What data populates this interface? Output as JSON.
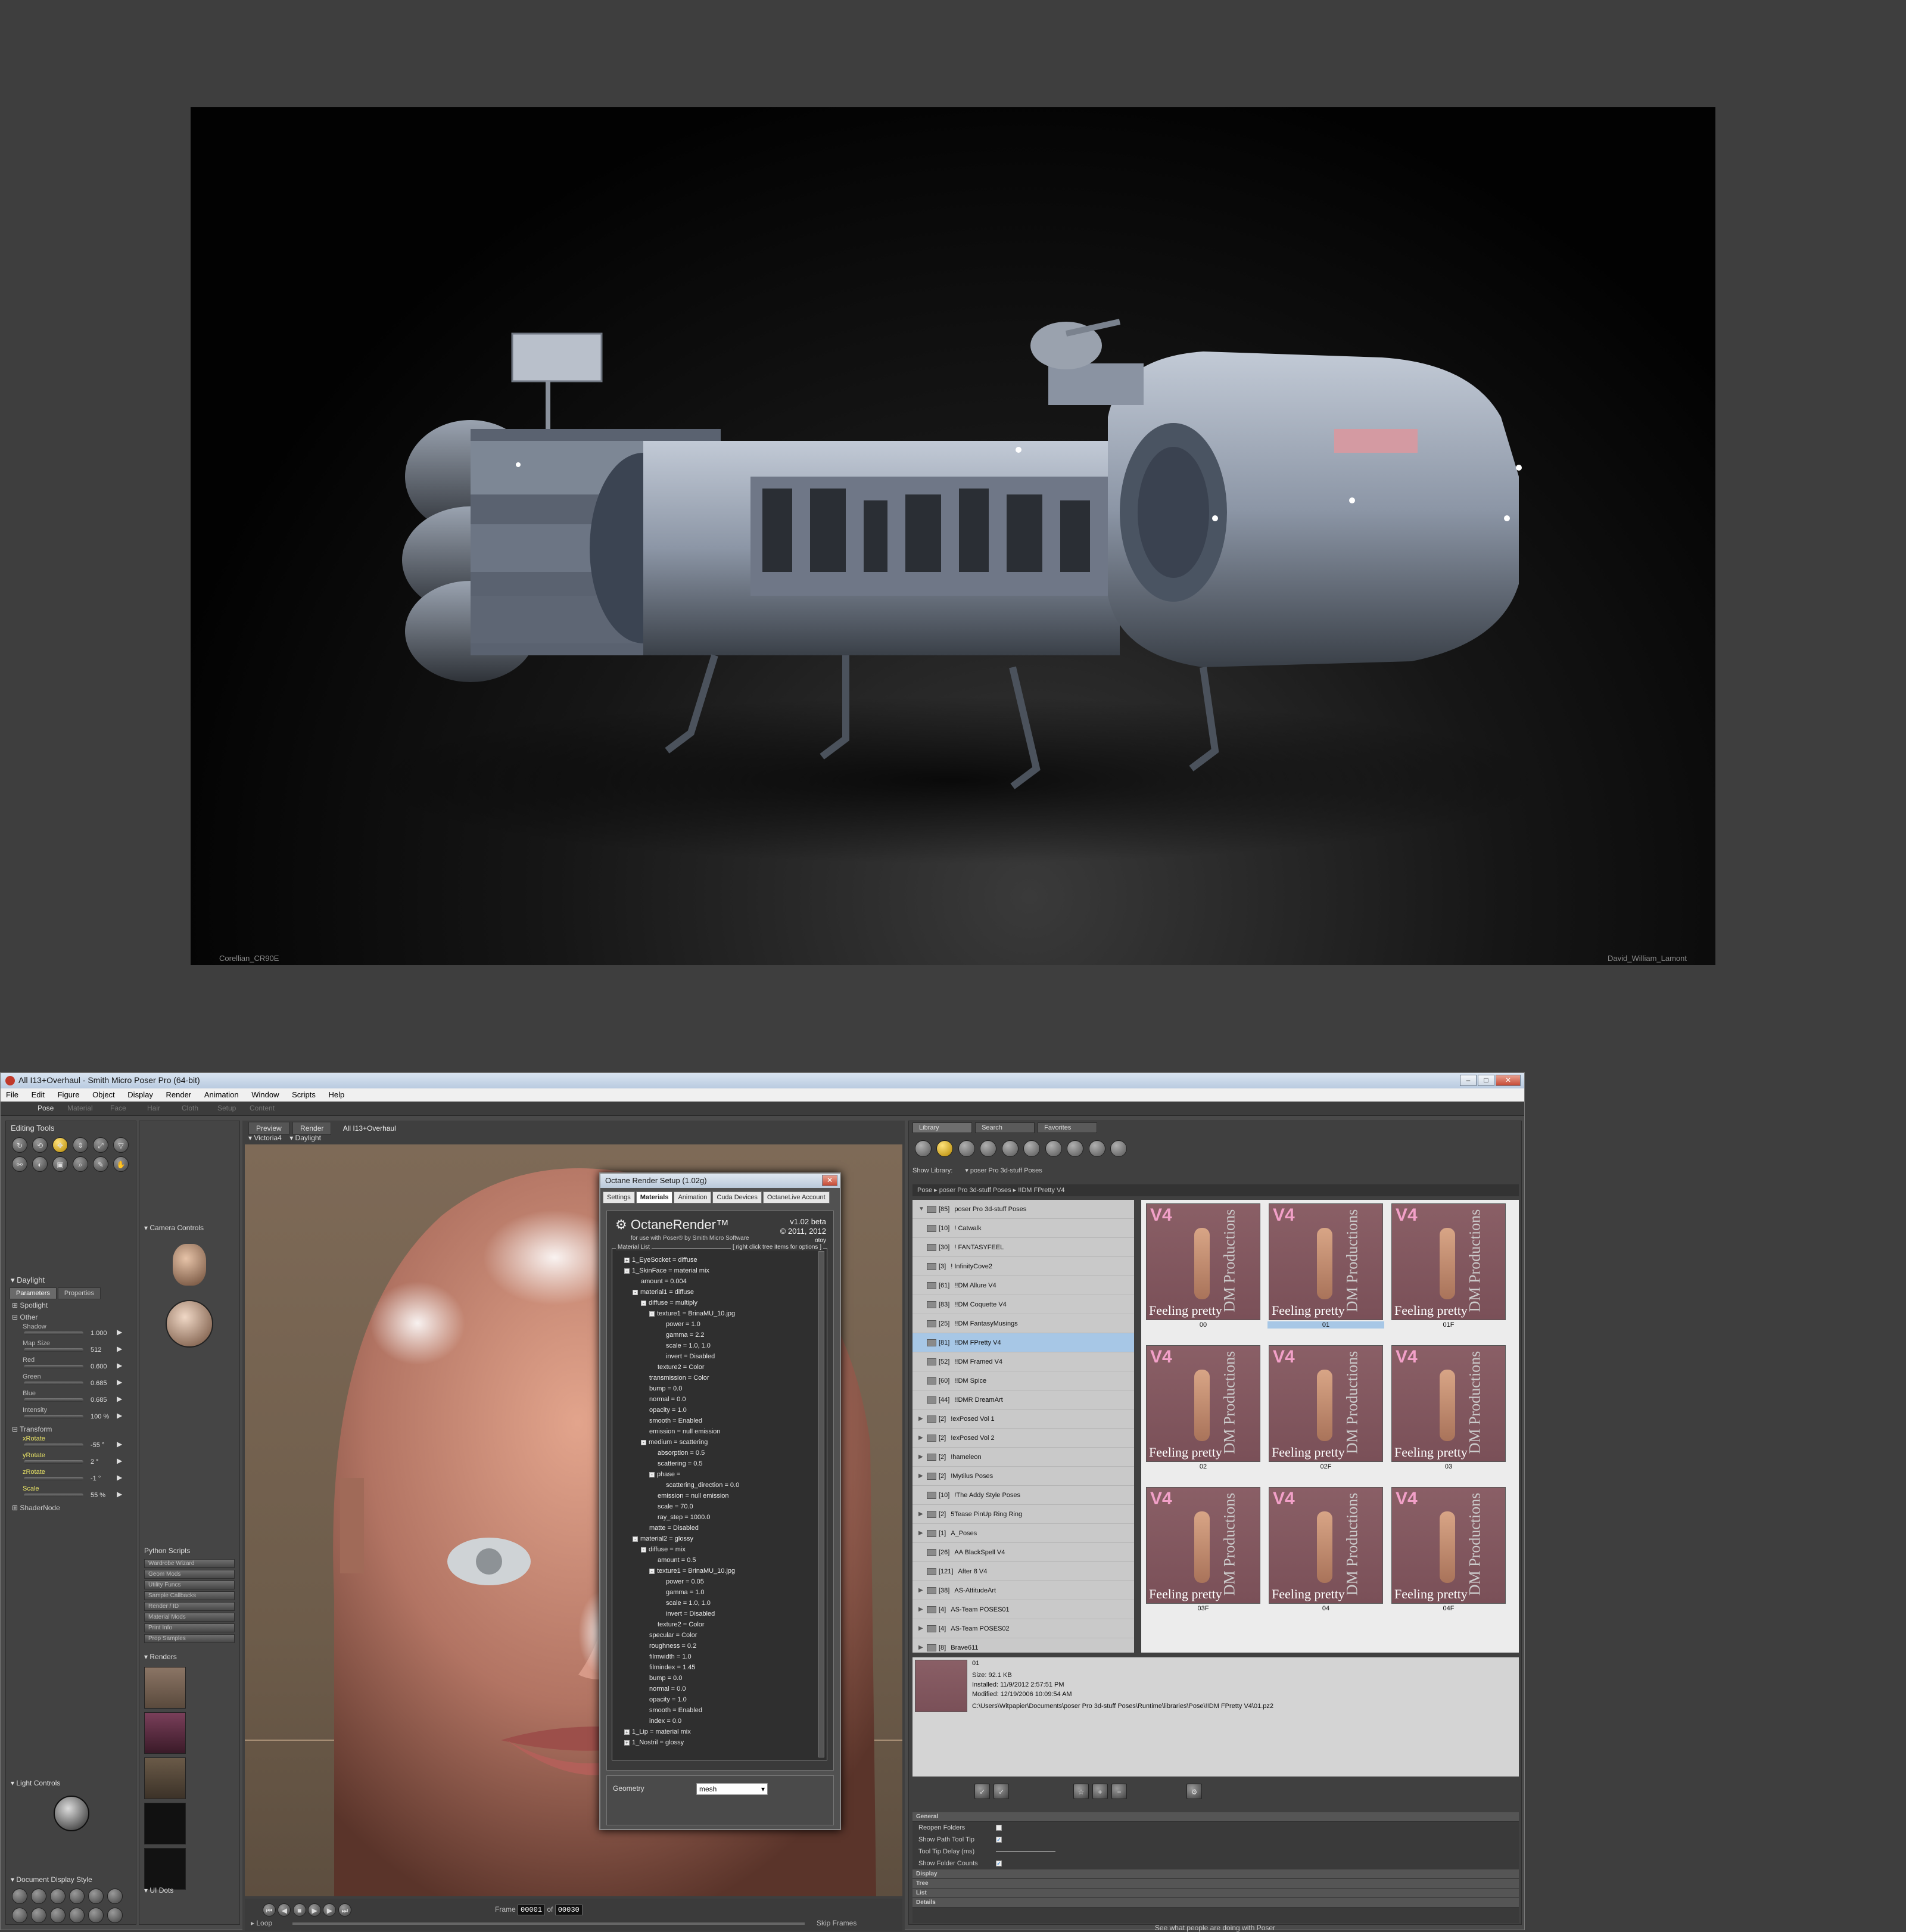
{
  "render": {
    "caption_left": "Corellian_CR90E",
    "caption_right": "David_William_Lamont"
  },
  "window": {
    "title": "All I13+Overhaul - Smith Micro Poser Pro  (64-bit)",
    "menu": [
      "File",
      "Edit",
      "Figure",
      "Object",
      "Display",
      "Render",
      "Animation",
      "Window",
      "Scripts",
      "Help"
    ],
    "rooms": [
      "Pose",
      "Material",
      "Face",
      "Hair",
      "Cloth",
      "Setup",
      "Content"
    ]
  },
  "left_panel": {
    "editing_tools_title": "Editing Tools",
    "light_title": "Daylight",
    "tabs": [
      "Parameters",
      "Properties"
    ],
    "groups": [
      "Spotlight",
      "Other",
      "Transform",
      "ShaderNode"
    ],
    "params": [
      {
        "name": "Shadow",
        "value": "1.000"
      },
      {
        "name": "Map Size",
        "value": "512"
      },
      {
        "name": "Red",
        "value": "0.600"
      },
      {
        "name": "Green",
        "value": "0.685"
      },
      {
        "name": "Blue",
        "value": "0.685"
      },
      {
        "name": "Intensity",
        "value": "100 %"
      }
    ],
    "transform": [
      {
        "name": "xRotate",
        "value": "-55 °"
      },
      {
        "name": "yRotate",
        "value": "2 °"
      },
      {
        "name": "zRotate",
        "value": "-1 °"
      },
      {
        "name": "Scale",
        "value": "55 %"
      }
    ],
    "light_controls": "Light Controls",
    "doc_display_style": "Document Display Style"
  },
  "camera_col": {
    "camera_controls": "Camera Controls",
    "python_title": "Python Scripts",
    "python_buttons": [
      "Wardrobe Wizard",
      "Geom Mods",
      "Utility Funcs",
      "Sample Callbacks",
      "Render / ID",
      "Material Mods",
      "Print Info",
      "Prop Samples"
    ],
    "renders_title": "Renders",
    "ui_dots": "UI Dots"
  },
  "viewport": {
    "tabs": [
      "Preview",
      "Render"
    ],
    "doc_name": "All I13+Overhaul",
    "figure_menu": "Victoria4",
    "actor_menu": "Daylight",
    "frame_label": "Frame",
    "frame_value": "00001",
    "of_label": "of",
    "frame_total": "00030",
    "loop_label": "Loop",
    "skip_frames": "Skip Frames"
  },
  "octane": {
    "title": "Octane Render Setup (1.02g)",
    "tabs": [
      "Settings",
      "Materials",
      "Animation",
      "Cuda Devices",
      "OctaneLive Account"
    ],
    "logo": "OctaneRender™",
    "subtitle": "for use with Poser® by Smith Micro Software",
    "version": "v1.02 beta",
    "copyright": "© 2011, 2012",
    "brand": "otoy",
    "list_title": "Material List",
    "hint": "[ right click tree items for options ]",
    "tree": [
      {
        "depth": 1,
        "exp": "+",
        "text": "1_EyeSocket = diffuse"
      },
      {
        "depth": 1,
        "exp": "-",
        "text": "1_SkinFace = material mix"
      },
      {
        "depth": 2,
        "exp": "",
        "text": "amount = 0.004"
      },
      {
        "depth": 2,
        "exp": "-",
        "text": "material1 = diffuse"
      },
      {
        "depth": 3,
        "exp": "-",
        "text": "diffuse = multiply"
      },
      {
        "depth": 4,
        "exp": "-",
        "text": "texture1 = BrinaMU_10.jpg"
      },
      {
        "depth": 5,
        "exp": "",
        "text": "power = 1.0"
      },
      {
        "depth": 5,
        "exp": "",
        "text": "gamma = 2.2"
      },
      {
        "depth": 5,
        "exp": "",
        "text": "scale = 1.0, 1.0"
      },
      {
        "depth": 5,
        "exp": "",
        "text": "invert = Disabled"
      },
      {
        "depth": 4,
        "exp": "",
        "text": "texture2 = Color"
      },
      {
        "depth": 3,
        "exp": "",
        "text": "transmission = Color"
      },
      {
        "depth": 3,
        "exp": "",
        "text": "bump = 0.0"
      },
      {
        "depth": 3,
        "exp": "",
        "text": "normal = 0.0"
      },
      {
        "depth": 3,
        "exp": "",
        "text": "opacity = 1.0"
      },
      {
        "depth": 3,
        "exp": "",
        "text": "smooth = Enabled"
      },
      {
        "depth": 3,
        "exp": "",
        "text": "emission = null emission"
      },
      {
        "depth": 3,
        "exp": "-",
        "text": "medium = scattering"
      },
      {
        "depth": 4,
        "exp": "",
        "text": "absorption = 0.5"
      },
      {
        "depth": 4,
        "exp": "",
        "text": "scattering = 0.5"
      },
      {
        "depth": 4,
        "exp": "-",
        "text": "phase ="
      },
      {
        "depth": 5,
        "exp": "",
        "text": "scattering_direction = 0.0"
      },
      {
        "depth": 4,
        "exp": "",
        "text": "emission = null emission"
      },
      {
        "depth": 4,
        "exp": "",
        "text": "scale = 70.0"
      },
      {
        "depth": 4,
        "exp": "",
        "text": "ray_step = 1000.0"
      },
      {
        "depth": 3,
        "exp": "",
        "text": "matte = Disabled"
      },
      {
        "depth": 2,
        "exp": "-",
        "text": "material2 = glossy"
      },
      {
        "depth": 3,
        "exp": "-",
        "text": "diffuse = mix"
      },
      {
        "depth": 4,
        "exp": "",
        "text": "amount = 0.5"
      },
      {
        "depth": 4,
        "exp": "-",
        "text": "texture1 = BrinaMU_10.jpg"
      },
      {
        "depth": 5,
        "exp": "",
        "text": "power = 0.05"
      },
      {
        "depth": 5,
        "exp": "",
        "text": "gamma = 1.0"
      },
      {
        "depth": 5,
        "exp": "",
        "text": "scale = 1.0, 1.0"
      },
      {
        "depth": 5,
        "exp": "",
        "text": "invert = Disabled"
      },
      {
        "depth": 4,
        "exp": "",
        "text": "texture2 = Color"
      },
      {
        "depth": 3,
        "exp": "",
        "text": "specular = Color"
      },
      {
        "depth": 3,
        "exp": "",
        "text": "roughness = 0.2"
      },
      {
        "depth": 3,
        "exp": "",
        "text": "filmwidth = 1.0"
      },
      {
        "depth": 3,
        "exp": "",
        "text": "filmindex = 1.45"
      },
      {
        "depth": 3,
        "exp": "",
        "text": "bump = 0.0"
      },
      {
        "depth": 3,
        "exp": "",
        "text": "normal = 0.0"
      },
      {
        "depth": 3,
        "exp": "",
        "text": "opacity = 1.0"
      },
      {
        "depth": 3,
        "exp": "",
        "text": "smooth = Enabled"
      },
      {
        "depth": 3,
        "exp": "",
        "text": "index = 0.0"
      },
      {
        "depth": 1,
        "exp": "+",
        "text": "1_Lip = material mix"
      },
      {
        "depth": 1,
        "exp": "+",
        "text": "1_Nostril = glossy"
      }
    ],
    "geometry_label": "Geometry",
    "geometry_value": "mesh"
  },
  "library": {
    "tabs": [
      "Library",
      "Search",
      "Favorites"
    ],
    "show_library_label": "Show Library:",
    "show_library_value": "poser Pro 3d-stuff Poses",
    "path": [
      "Pose",
      "poser Pro 3d-stuff Poses",
      "!!DM FPretty V4"
    ],
    "folders": [
      {
        "count": "[85]",
        "name": "poser Pro 3d-stuff Poses",
        "expand": "▼"
      },
      {
        "count": "[10]",
        "name": "!  Catwalk",
        "expand": ""
      },
      {
        "count": "[30]",
        "name": "!  FANTASYFEEL",
        "expand": ""
      },
      {
        "count": "[3]",
        "name": "! InfinityCove2",
        "expand": ""
      },
      {
        "count": "[61]",
        "name": "!!DM Allure V4",
        "expand": ""
      },
      {
        "count": "[83]",
        "name": "!!DM Coquette V4",
        "expand": ""
      },
      {
        "count": "[25]",
        "name": "!!DM FantasyMusings",
        "expand": ""
      },
      {
        "count": "[81]",
        "name": "!!DM FPretty V4",
        "expand": "",
        "selected": true
      },
      {
        "count": "[52]",
        "name": "!!DM Framed V4",
        "expand": ""
      },
      {
        "count": "[60]",
        "name": "!!DM Spice",
        "expand": ""
      },
      {
        "count": "[44]",
        "name": "!!DMR DreamArt",
        "expand": ""
      },
      {
        "count": "[2]",
        "name": "!exPosed Vol 1",
        "expand": "▶"
      },
      {
        "count": "[2]",
        "name": "!exPosed Vol 2",
        "expand": "▶"
      },
      {
        "count": "[2]",
        "name": "!hameleon",
        "expand": "▶"
      },
      {
        "count": "[2]",
        "name": "!Mytilus Poses",
        "expand": "▶"
      },
      {
        "count": "[10]",
        "name": "!The Addy Style Poses",
        "expand": ""
      },
      {
        "count": "[2]",
        "name": "5Tease PinUp Ring Ring",
        "expand": "▶"
      },
      {
        "count": "[1]",
        "name": "A_Poses",
        "expand": "▶"
      },
      {
        "count": "[26]",
        "name": "AA BlackSpell V4",
        "expand": ""
      },
      {
        "count": "[121]",
        "name": "After 8 V4",
        "expand": ""
      },
      {
        "count": "[38]",
        "name": "AS-AttitudeArt",
        "expand": "▶"
      },
      {
        "count": "[4]",
        "name": "AS-Team POSES01",
        "expand": "▶"
      },
      {
        "count": "[4]",
        "name": "AS-Team POSES02",
        "expand": "▶"
      },
      {
        "count": "[8]",
        "name": "Brave611",
        "expand": "▶"
      }
    ],
    "thumbs": [
      {
        "label": "00"
      },
      {
        "label": "01",
        "selected": true
      },
      {
        "label": "01F"
      },
      {
        "label": "02"
      },
      {
        "label": "02F"
      },
      {
        "label": "03"
      },
      {
        "label": "03F"
      },
      {
        "label": "04"
      },
      {
        "label": "04F"
      }
    ],
    "thumb_badge": "V4",
    "thumb_caption": "Feeling pretty",
    "thumb_brand": "DM Productions",
    "info": {
      "name": "01",
      "size": "Size: 92.1 KB",
      "installed": "Installed: 11/9/2012 2:57:51 PM",
      "modified": "Modified: 12/19/2006 10:09:54 AM",
      "path": "C:\\Users\\Witpapier\\Documents\\poser Pro 3d-stuff Poses\\Runtime\\libraries\\Pose\\!!DM FPretty V4\\01.pz2"
    },
    "prefs": {
      "general": "General",
      "rows": [
        {
          "label": "Reopen Folders",
          "checked": false
        },
        {
          "label": "Show Path Tool Tip",
          "checked": true
        },
        {
          "label": "Tool Tip Delay (ms)",
          "checked": false,
          "slider": true
        },
        {
          "label": "Show Folder Counts",
          "checked": true
        }
      ],
      "sections": [
        "Display",
        "Tree",
        "List",
        "Details"
      ]
    },
    "status": "See what people are doing with Poser"
  }
}
